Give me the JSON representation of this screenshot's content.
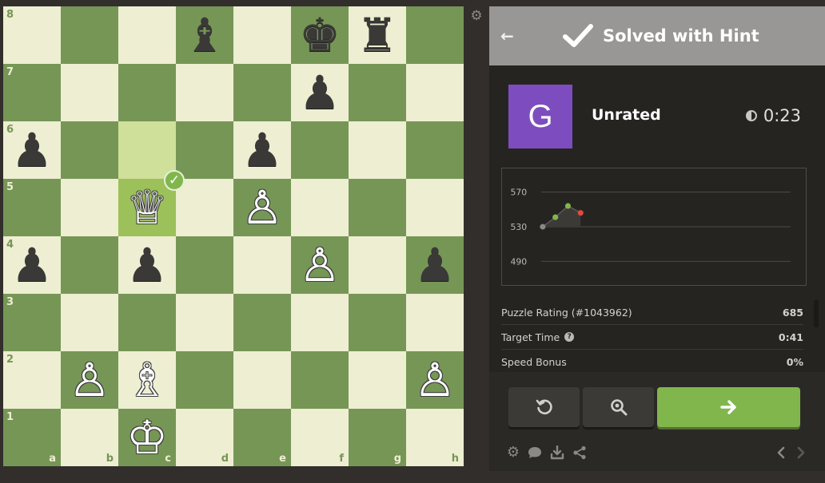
{
  "board": {
    "files": [
      "a",
      "b",
      "c",
      "d",
      "e",
      "f",
      "g",
      "h"
    ],
    "ranks": [
      "8",
      "7",
      "6",
      "5",
      "4",
      "3",
      "2",
      "1"
    ],
    "pieces": [
      {
        "square": "d8",
        "color": "b",
        "type": "bishop",
        "glyph": "♝"
      },
      {
        "square": "f8",
        "color": "b",
        "type": "king",
        "glyph": "♚"
      },
      {
        "square": "g8",
        "color": "b",
        "type": "rook",
        "glyph": "♜"
      },
      {
        "square": "f7",
        "color": "b",
        "type": "pawn",
        "glyph": "♟"
      },
      {
        "square": "a6",
        "color": "b",
        "type": "pawn",
        "glyph": "♟"
      },
      {
        "square": "e6",
        "color": "b",
        "type": "pawn",
        "glyph": "♟"
      },
      {
        "square": "c5",
        "color": "w",
        "type": "queen",
        "glyph": "♕"
      },
      {
        "square": "e5",
        "color": "w",
        "type": "pawn",
        "glyph": "♙"
      },
      {
        "square": "a4",
        "color": "b",
        "type": "pawn",
        "glyph": "♟"
      },
      {
        "square": "c4",
        "color": "b",
        "type": "pawn",
        "glyph": "♟"
      },
      {
        "square": "f4",
        "color": "w",
        "type": "pawn",
        "glyph": "♙"
      },
      {
        "square": "h4",
        "color": "b",
        "type": "pawn",
        "glyph": "♟"
      },
      {
        "square": "b2",
        "color": "w",
        "type": "pawn",
        "glyph": "♙"
      },
      {
        "square": "c2",
        "color": "w",
        "type": "bishop",
        "glyph": "♗"
      },
      {
        "square": "h2",
        "color": "w",
        "type": "pawn",
        "glyph": "♙"
      },
      {
        "square": "c1",
        "color": "w",
        "type": "king",
        "glyph": "♔"
      }
    ],
    "highlighted_squares": [
      "c6",
      "c5"
    ],
    "correct_move_badge_square": "c5",
    "light_color": "#eeeed2",
    "dark_color": "#769656",
    "settings_icon": "gear-icon"
  },
  "panel": {
    "header": {
      "title": "Solved with Hint",
      "back_icon": "back-arrow-icon",
      "status_icon": "checkmark-icon",
      "background": "#989795"
    },
    "player": {
      "avatar_letter": "G",
      "avatar_color": "#7d4dbf",
      "mode": "Unrated",
      "timer_icon": "half-circle-clock-icon",
      "timer": "0:23"
    },
    "stats": [
      {
        "label": "Puzzle Rating (#1043962)",
        "value": "685"
      },
      {
        "label": "Target Time",
        "value": "0:41",
        "help_icon": true
      },
      {
        "label": "Speed Bonus",
        "value": "0%"
      }
    ],
    "buttons": {
      "retry_icon": "retry-icon",
      "analysis_icon": "magnifier-icon",
      "next_icon": "arrow-right-icon"
    },
    "footer_icons": [
      "gear-icon",
      "chat-icon",
      "download-icon",
      "share-icon",
      "chevron-left-icon",
      "chevron-right-icon"
    ]
  },
  "chart_data": {
    "type": "line",
    "y_ticks": [
      "570",
      "530",
      "490"
    ],
    "ylim": [
      470,
      590
    ],
    "points": [
      {
        "x": 0,
        "y": 530,
        "color": "#8b8987"
      },
      {
        "x": 1,
        "y": 541,
        "color": "#81b64c"
      },
      {
        "x": 2,
        "y": 554,
        "color": "#81b64c"
      },
      {
        "x": 3,
        "y": 546,
        "color": "#e04a3f"
      }
    ],
    "fill_color": "#3c3a37",
    "grid": true
  }
}
